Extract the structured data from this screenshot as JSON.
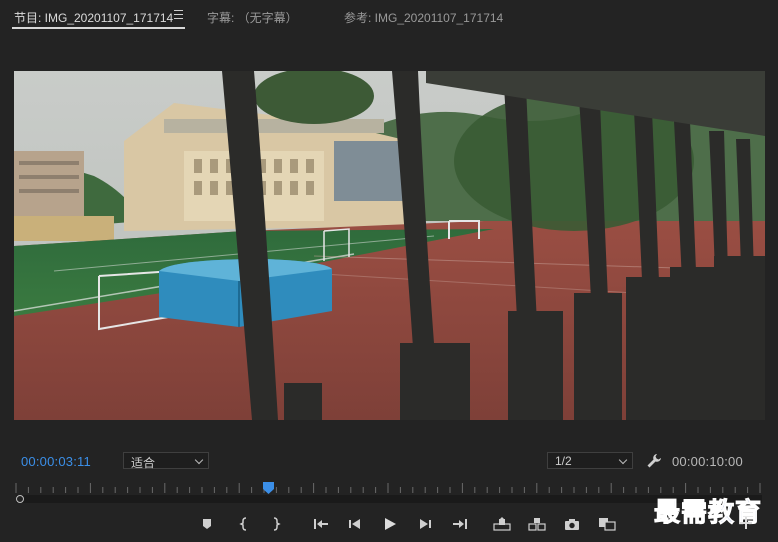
{
  "tabs": {
    "program": "节目: IMG_20201107_171714",
    "captions": "字幕: （无字幕）",
    "reference": "参考: IMG_20201107_171714"
  },
  "icons": {
    "panel_menu": "hamburger-menu-icon",
    "settings": "wrench-icon",
    "playhead": "playhead-marker-icon",
    "add_marker": "marker-icon",
    "mark_in": "mark-in-icon",
    "mark_out": "mark-out-icon",
    "go_to_in": "go-to-in-icon",
    "step_back": "step-back-icon",
    "play": "play-icon",
    "step_forward": "step-forward-icon",
    "go_to_out": "go-to-out-icon",
    "lift": "lift-icon",
    "extract": "extract-icon",
    "export_frame": "camera-icon",
    "comparison_view": "comparison-view-icon",
    "button_editor": "plus-icon"
  },
  "viewer": {
    "scene": "video-frame"
  },
  "controls": {
    "current_timecode": "00:00:03:11",
    "zoom_value": "适合",
    "resolution_value": "1/2",
    "duration_timecode": "00:00:10:00"
  },
  "playback": {
    "playhead_fraction": 0.34
  },
  "watermark": "最需教育",
  "colors": {
    "accent": "#3b8fe8",
    "panel_bg": "#232323",
    "watermark": "#1d3fa8"
  }
}
